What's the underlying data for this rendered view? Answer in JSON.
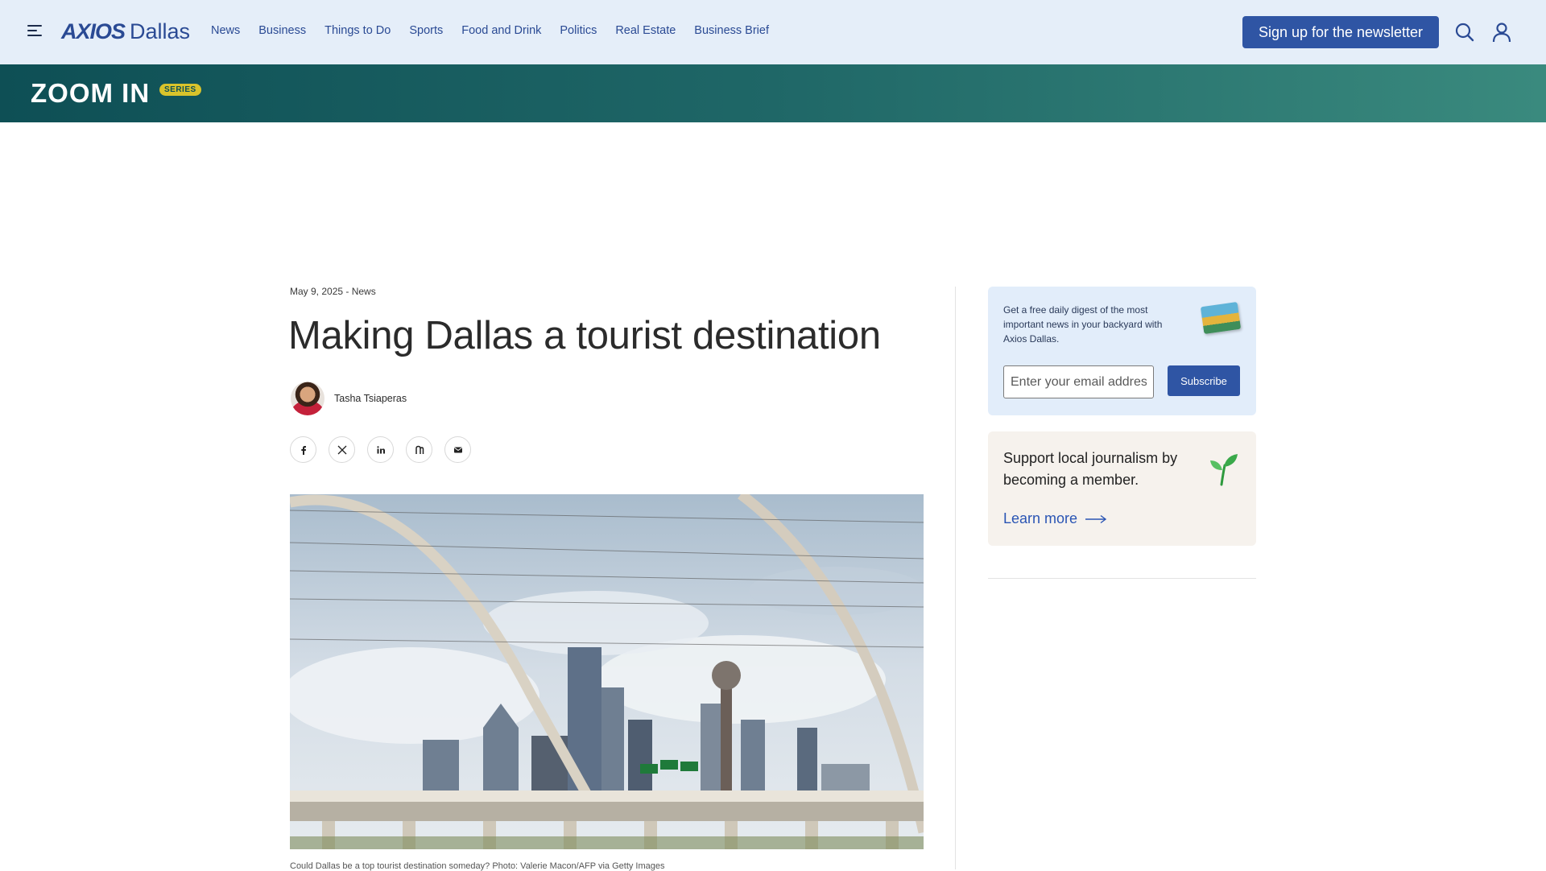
{
  "header": {
    "logo_brand": "AXIOS",
    "logo_city": "Dallas",
    "nav": [
      "News",
      "Business",
      "Things to Do",
      "Sports",
      "Food and Drink",
      "Politics",
      "Real Estate",
      "Business Brief"
    ],
    "newsletter_label": "Sign up for the newsletter",
    "icons": [
      "menu-icon",
      "search-icon",
      "user-icon"
    ]
  },
  "banner": {
    "title": "ZOOM IN",
    "badge": "SERIES"
  },
  "article": {
    "meta": "May 9, 2025 - News",
    "headline": "Making Dallas a tourist destination",
    "author": "Tasha Tsiaperas",
    "share_icons": [
      "facebook-icon",
      "x-icon",
      "linkedin-icon",
      "threads-icon",
      "email-icon"
    ],
    "caption": "Could Dallas be a top tourist destination someday? Photo: Valerie Macon/AFP via Getty Images"
  },
  "sidebar": {
    "signup_text": "Get a free daily digest of the most important news in your backyard with Axios Dallas.",
    "email_placeholder": "Enter your email address",
    "subscribe_label": "Subscribe",
    "member_text": "Support local journalism by becoming a member.",
    "learn_more": "Learn more"
  },
  "colors": {
    "accent": "#2f55a4",
    "header_bg": "#e5eef9",
    "banner_start": "#0e4f55",
    "banner_end": "#3a8a7e",
    "badge": "#d9c32b"
  }
}
